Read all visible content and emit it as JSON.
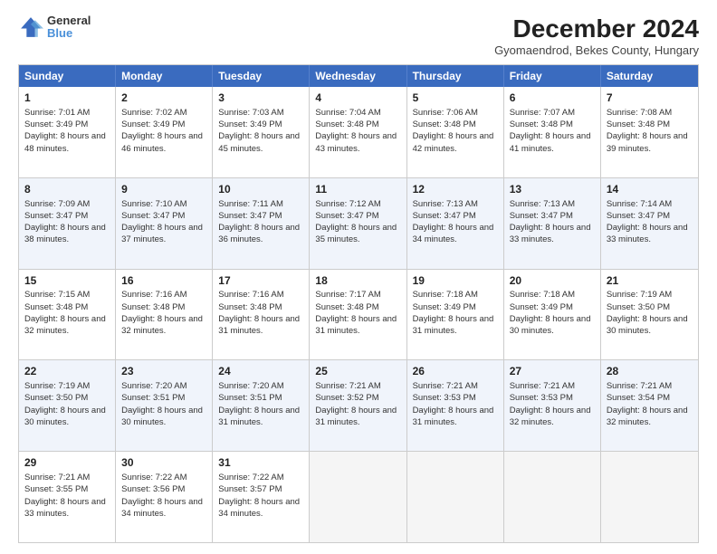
{
  "header": {
    "logo_general": "General",
    "logo_blue": "Blue",
    "month_title": "December 2024",
    "subtitle": "Gyomaendrod, Bekes County, Hungary"
  },
  "days_of_week": [
    "Sunday",
    "Monday",
    "Tuesday",
    "Wednesday",
    "Thursday",
    "Friday",
    "Saturday"
  ],
  "weeks": [
    [
      {
        "day": 1,
        "sunrise": "Sunrise: 7:01 AM",
        "sunset": "Sunset: 3:49 PM",
        "daylight": "Daylight: 8 hours and 48 minutes."
      },
      {
        "day": 2,
        "sunrise": "Sunrise: 7:02 AM",
        "sunset": "Sunset: 3:49 PM",
        "daylight": "Daylight: 8 hours and 46 minutes."
      },
      {
        "day": 3,
        "sunrise": "Sunrise: 7:03 AM",
        "sunset": "Sunset: 3:49 PM",
        "daylight": "Daylight: 8 hours and 45 minutes."
      },
      {
        "day": 4,
        "sunrise": "Sunrise: 7:04 AM",
        "sunset": "Sunset: 3:48 PM",
        "daylight": "Daylight: 8 hours and 43 minutes."
      },
      {
        "day": 5,
        "sunrise": "Sunrise: 7:06 AM",
        "sunset": "Sunset: 3:48 PM",
        "daylight": "Daylight: 8 hours and 42 minutes."
      },
      {
        "day": 6,
        "sunrise": "Sunrise: 7:07 AM",
        "sunset": "Sunset: 3:48 PM",
        "daylight": "Daylight: 8 hours and 41 minutes."
      },
      {
        "day": 7,
        "sunrise": "Sunrise: 7:08 AM",
        "sunset": "Sunset: 3:48 PM",
        "daylight": "Daylight: 8 hours and 39 minutes."
      }
    ],
    [
      {
        "day": 8,
        "sunrise": "Sunrise: 7:09 AM",
        "sunset": "Sunset: 3:47 PM",
        "daylight": "Daylight: 8 hours and 38 minutes."
      },
      {
        "day": 9,
        "sunrise": "Sunrise: 7:10 AM",
        "sunset": "Sunset: 3:47 PM",
        "daylight": "Daylight: 8 hours and 37 minutes."
      },
      {
        "day": 10,
        "sunrise": "Sunrise: 7:11 AM",
        "sunset": "Sunset: 3:47 PM",
        "daylight": "Daylight: 8 hours and 36 minutes."
      },
      {
        "day": 11,
        "sunrise": "Sunrise: 7:12 AM",
        "sunset": "Sunset: 3:47 PM",
        "daylight": "Daylight: 8 hours and 35 minutes."
      },
      {
        "day": 12,
        "sunrise": "Sunrise: 7:13 AM",
        "sunset": "Sunset: 3:47 PM",
        "daylight": "Daylight: 8 hours and 34 minutes."
      },
      {
        "day": 13,
        "sunrise": "Sunrise: 7:13 AM",
        "sunset": "Sunset: 3:47 PM",
        "daylight": "Daylight: 8 hours and 33 minutes."
      },
      {
        "day": 14,
        "sunrise": "Sunrise: 7:14 AM",
        "sunset": "Sunset: 3:47 PM",
        "daylight": "Daylight: 8 hours and 33 minutes."
      }
    ],
    [
      {
        "day": 15,
        "sunrise": "Sunrise: 7:15 AM",
        "sunset": "Sunset: 3:48 PM",
        "daylight": "Daylight: 8 hours and 32 minutes."
      },
      {
        "day": 16,
        "sunrise": "Sunrise: 7:16 AM",
        "sunset": "Sunset: 3:48 PM",
        "daylight": "Daylight: 8 hours and 32 minutes."
      },
      {
        "day": 17,
        "sunrise": "Sunrise: 7:16 AM",
        "sunset": "Sunset: 3:48 PM",
        "daylight": "Daylight: 8 hours and 31 minutes."
      },
      {
        "day": 18,
        "sunrise": "Sunrise: 7:17 AM",
        "sunset": "Sunset: 3:48 PM",
        "daylight": "Daylight: 8 hours and 31 minutes."
      },
      {
        "day": 19,
        "sunrise": "Sunrise: 7:18 AM",
        "sunset": "Sunset: 3:49 PM",
        "daylight": "Daylight: 8 hours and 31 minutes."
      },
      {
        "day": 20,
        "sunrise": "Sunrise: 7:18 AM",
        "sunset": "Sunset: 3:49 PM",
        "daylight": "Daylight: 8 hours and 30 minutes."
      },
      {
        "day": 21,
        "sunrise": "Sunrise: 7:19 AM",
        "sunset": "Sunset: 3:50 PM",
        "daylight": "Daylight: 8 hours and 30 minutes."
      }
    ],
    [
      {
        "day": 22,
        "sunrise": "Sunrise: 7:19 AM",
        "sunset": "Sunset: 3:50 PM",
        "daylight": "Daylight: 8 hours and 30 minutes."
      },
      {
        "day": 23,
        "sunrise": "Sunrise: 7:20 AM",
        "sunset": "Sunset: 3:51 PM",
        "daylight": "Daylight: 8 hours and 30 minutes."
      },
      {
        "day": 24,
        "sunrise": "Sunrise: 7:20 AM",
        "sunset": "Sunset: 3:51 PM",
        "daylight": "Daylight: 8 hours and 31 minutes."
      },
      {
        "day": 25,
        "sunrise": "Sunrise: 7:21 AM",
        "sunset": "Sunset: 3:52 PM",
        "daylight": "Daylight: 8 hours and 31 minutes."
      },
      {
        "day": 26,
        "sunrise": "Sunrise: 7:21 AM",
        "sunset": "Sunset: 3:53 PM",
        "daylight": "Daylight: 8 hours and 31 minutes."
      },
      {
        "day": 27,
        "sunrise": "Sunrise: 7:21 AM",
        "sunset": "Sunset: 3:53 PM",
        "daylight": "Daylight: 8 hours and 32 minutes."
      },
      {
        "day": 28,
        "sunrise": "Sunrise: 7:21 AM",
        "sunset": "Sunset: 3:54 PM",
        "daylight": "Daylight: 8 hours and 32 minutes."
      }
    ],
    [
      {
        "day": 29,
        "sunrise": "Sunrise: 7:21 AM",
        "sunset": "Sunset: 3:55 PM",
        "daylight": "Daylight: 8 hours and 33 minutes."
      },
      {
        "day": 30,
        "sunrise": "Sunrise: 7:22 AM",
        "sunset": "Sunset: 3:56 PM",
        "daylight": "Daylight: 8 hours and 34 minutes."
      },
      {
        "day": 31,
        "sunrise": "Sunrise: 7:22 AM",
        "sunset": "Sunset: 3:57 PM",
        "daylight": "Daylight: 8 hours and 34 minutes."
      },
      null,
      null,
      null,
      null
    ]
  ]
}
